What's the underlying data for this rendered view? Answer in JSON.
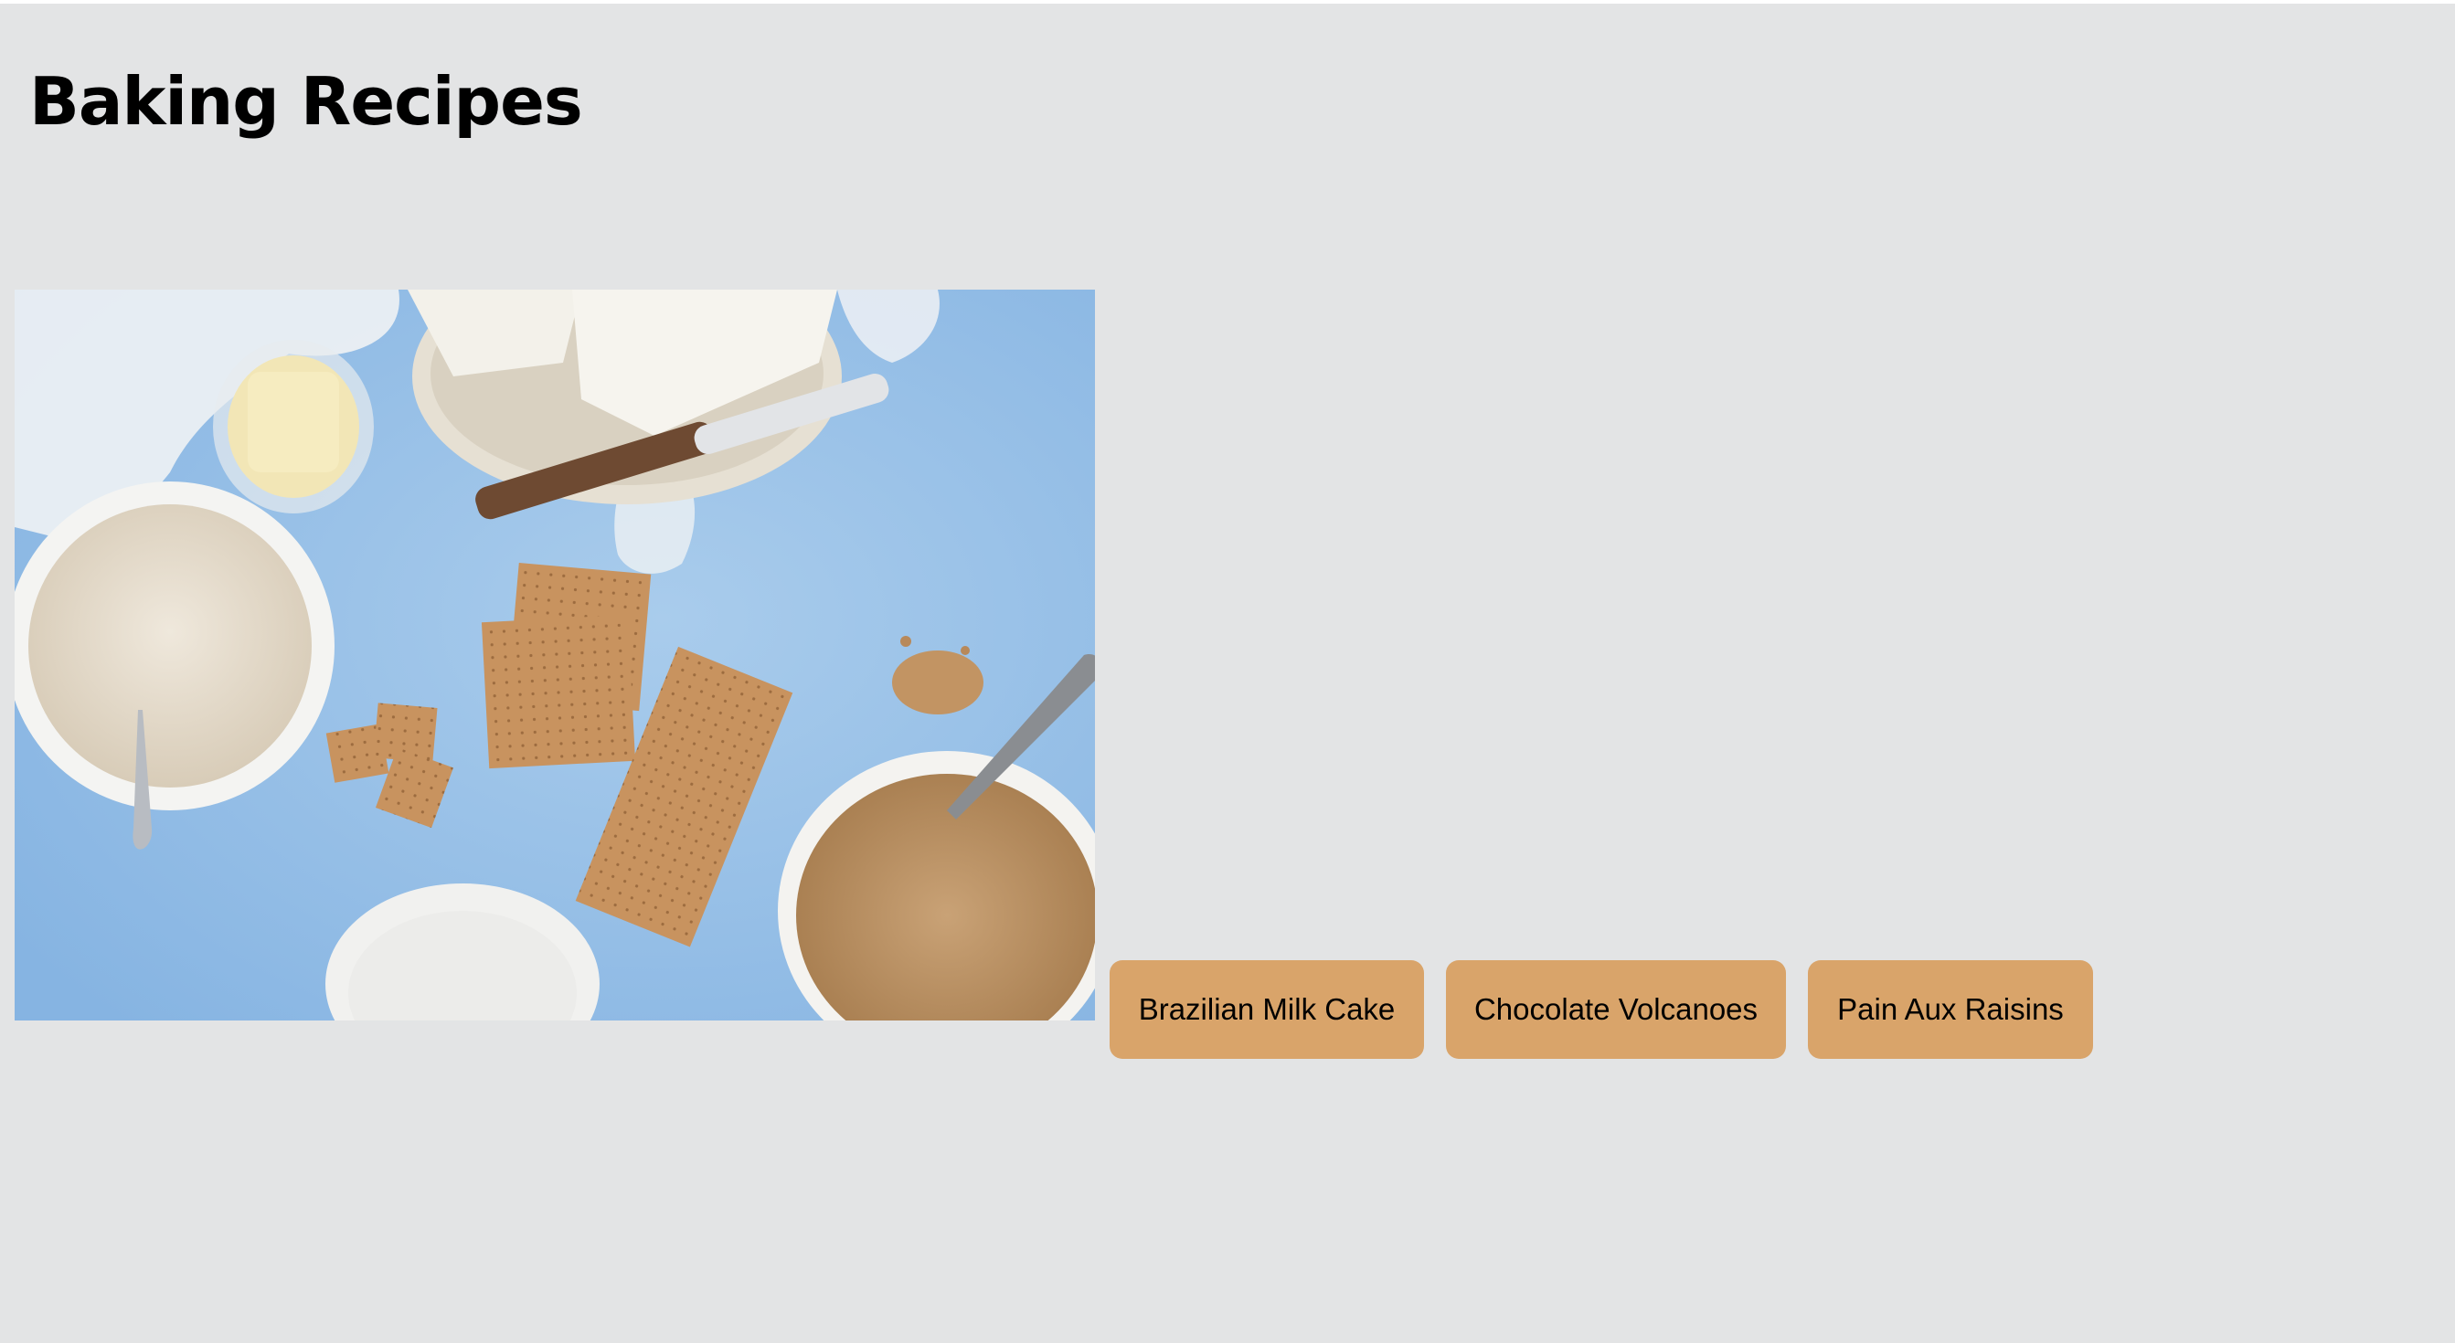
{
  "page": {
    "title": "Baking Recipes",
    "background_color": "#e3e4e5"
  },
  "hero": {
    "image_alt": "Baking ingredients on a blue table: flour, butter, cream cheese, graham crackers, sugar and brown sugar"
  },
  "buttons": {
    "accent_color": "#d9a46a",
    "items": [
      {
        "label": "Brazilian Milk Cake"
      },
      {
        "label": "Chocolate Volcanoes"
      },
      {
        "label": "Pain Aux Raisins"
      }
    ]
  }
}
